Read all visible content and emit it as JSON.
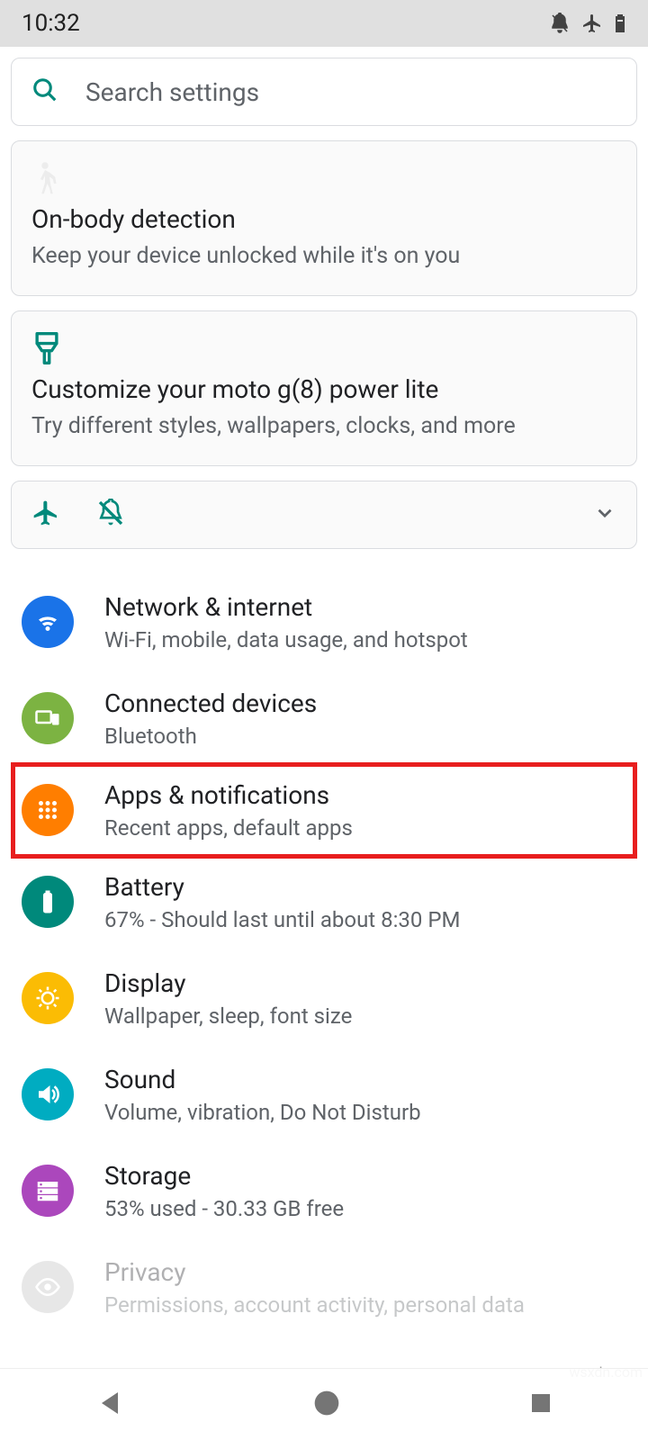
{
  "status_bar": {
    "time": "10:32",
    "icons": [
      "dnd-off-icon",
      "airplane-icon",
      "battery-icon"
    ]
  },
  "search": {
    "placeholder": "Search settings"
  },
  "promos": [
    {
      "id": "onbody",
      "icon": "walk-icon",
      "title": "On-body detection",
      "subtitle": "Keep your device unlocked while it's on you"
    },
    {
      "id": "customize",
      "icon": "brush-icon",
      "title": "Customize your moto g(8) power lite",
      "subtitle": "Try different styles, wallpapers, clocks, and more"
    }
  ],
  "quick_status": {
    "icons": [
      "airplane-icon",
      "dnd-off-icon"
    ]
  },
  "settings": [
    {
      "id": "network",
      "icon": "wifi-icon",
      "color": "c-blue",
      "title": "Network & internet",
      "subtitle": "Wi-Fi, mobile, data usage, and hotspot",
      "highlighted": false
    },
    {
      "id": "connected",
      "icon": "devices-icon",
      "color": "c-green",
      "title": "Connected devices",
      "subtitle": "Bluetooth",
      "highlighted": false
    },
    {
      "id": "apps",
      "icon": "apps-icon",
      "color": "c-orange",
      "title": "Apps & notifications",
      "subtitle": "Recent apps, default apps",
      "highlighted": true
    },
    {
      "id": "battery",
      "icon": "battery-icon",
      "color": "c-teal",
      "title": "Battery",
      "subtitle": "67% - Should last until about 8:30 PM",
      "highlighted": false
    },
    {
      "id": "display",
      "icon": "brightness-icon",
      "color": "c-amber",
      "title": "Display",
      "subtitle": "Wallpaper, sleep, font size",
      "highlighted": false
    },
    {
      "id": "sound",
      "icon": "sound-icon",
      "color": "c-cyan",
      "title": "Sound",
      "subtitle": "Volume, vibration, Do Not Disturb",
      "highlighted": false
    },
    {
      "id": "storage",
      "icon": "storage-icon",
      "color": "c-purple",
      "title": "Storage",
      "subtitle": "53% used - 30.33 GB free",
      "highlighted": false
    },
    {
      "id": "privacy",
      "icon": "privacy-icon",
      "color": "c-grey",
      "title": "Privacy",
      "subtitle": "Permissions, account activity, personal data",
      "highlighted": false,
      "faded": true
    }
  ],
  "watermark": "wsxdn.com",
  "colors": {
    "accent_teal": "#00897b",
    "highlight_red": "#e81e1e"
  }
}
